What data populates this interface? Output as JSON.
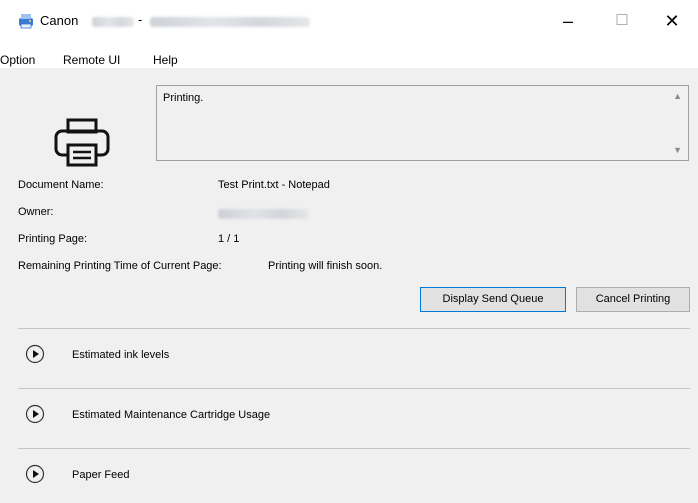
{
  "window": {
    "app_name": "Canon",
    "separator": "-",
    "controls": {
      "minimize": "–",
      "maximize": "☐",
      "close": "✕"
    }
  },
  "menu": [
    "Option",
    "Remote UI",
    "Help"
  ],
  "status": {
    "message": "Printing.",
    "scroll_up": "▲",
    "scroll_down": "▼"
  },
  "info": {
    "document_label": "Document Name:",
    "document_value": "Test Print.txt - Notepad",
    "owner_label": "Owner:",
    "page_label": "Printing Page:",
    "page_value": "1 / 1",
    "remaining_label": "Remaining Printing Time of Current Page:",
    "remaining_value": "Printing will finish soon."
  },
  "buttons": {
    "display_queue": "Display Send Queue",
    "cancel_printing": "Cancel Printing"
  },
  "sections": [
    "Estimated ink levels",
    "Estimated Maintenance Cartridge Usage",
    "Paper Feed"
  ],
  "colors": {
    "focus_border": "#0078d7",
    "background": "#f0f0f0"
  }
}
